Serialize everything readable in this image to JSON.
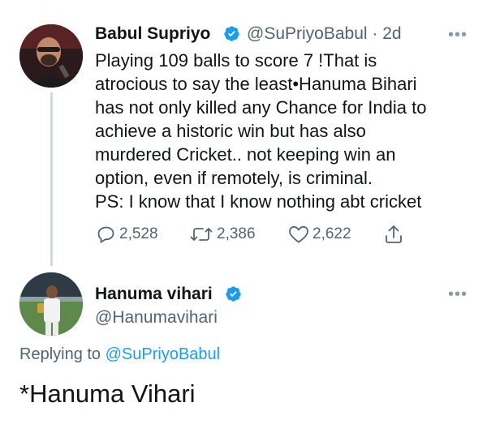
{
  "tweet": {
    "author_name": "Babul Supriyo",
    "author_handle": "@SuPriyoBabul",
    "time": "· 2d",
    "body_lines": [
      "Playing 109 balls to score 7 !That is",
      "atrocious to say the least•Hanuma Bihari",
      "has not only killed any Chance for India to",
      "achieve a historic win but has also",
      "murdered Cricket.. not keeping win an",
      "option, even if remotely, is criminal.",
      "PS: I know that I know nothing abt cricket"
    ],
    "replies_count": "2,528",
    "retweets_count": "2,386",
    "likes_count": "2,622",
    "more_label": "•••"
  },
  "reply": {
    "author_name": "Hanuma vihari",
    "author_handle": "@Hanumavihari",
    "replying_prefix": "Replying to ",
    "replying_mention": "@SuPriyoBabul",
    "text": "*Hanuma Vihari",
    "more_label": "•••"
  },
  "icons": {
    "reply": "reply-icon",
    "retweet": "retweet-icon",
    "like": "heart-icon",
    "share": "share-icon",
    "verified": "verified-badge-icon",
    "more": "more-options-icon"
  },
  "colors": {
    "brand_blue": "#1d9bf0",
    "secondary_text": "#536471",
    "primary_text": "#0f1419"
  }
}
